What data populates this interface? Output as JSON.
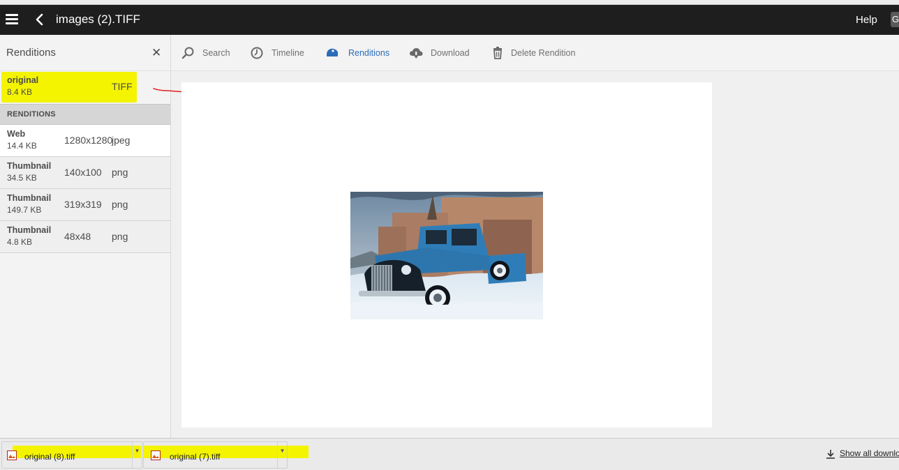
{
  "header": {
    "title": "images (2).TIFF",
    "help_label": "Help",
    "help_edge_char": "G"
  },
  "rail": {
    "title": "Renditions",
    "close_glyph": "✕",
    "original": {
      "name": "original",
      "size": "8.4 KB",
      "format": "TIFF"
    },
    "section_label": "RENDITIONS",
    "items": [
      {
        "name": "Web",
        "size": "14.4 KB",
        "dimensions": "1280x1280",
        "format": "jpeg"
      },
      {
        "name": "Thumbnail",
        "size": "34.5 KB",
        "dimensions": "140x100",
        "format": "png"
      },
      {
        "name": "Thumbnail",
        "size": "149.7 KB",
        "dimensions": "319x319",
        "format": "png"
      },
      {
        "name": "Thumbnail",
        "size": "4.8 KB",
        "dimensions": "48x48",
        "format": "png"
      }
    ]
  },
  "toolbar": {
    "search_label": "Search",
    "timeline_label": "Timeline",
    "renditions_label": "Renditions",
    "download_label": "Download",
    "delete_label": "Delete Rendition"
  },
  "downloads": {
    "items": [
      {
        "name": "original (8).tiff"
      },
      {
        "name": "original (7).tiff"
      }
    ],
    "show_all_label": "Show all downloads"
  },
  "colors": {
    "header_bg": "#1e1e1e",
    "accent_blue": "#2c6bb8",
    "highlight_yellow": "#f4f400",
    "annotation_red": "#e02020"
  },
  "icons": {
    "menu": "hamburger-icon",
    "back": "chevron-left-icon",
    "search": "search-icon",
    "timeline": "clock-icon",
    "renditions": "renditions-icon",
    "download": "cloud-download-icon",
    "delete": "trash-icon"
  }
}
